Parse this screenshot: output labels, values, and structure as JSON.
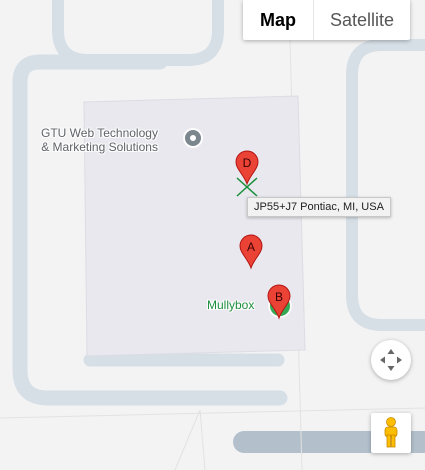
{
  "map_type": {
    "map_label": "Map",
    "satellite_label": "Satellite",
    "selected": "Map"
  },
  "places": {
    "gtu": {
      "line1": "GTU Web Technology",
      "line2": "& Marketing Solutions"
    },
    "mullybox": "Mullybox"
  },
  "markers": [
    {
      "label": "D"
    },
    {
      "label": "A"
    },
    {
      "label": "B"
    }
  ],
  "tooltip": "JP55+J7 Pontiac, MI, USA",
  "colors": {
    "background": "#f3f3f4",
    "road": "#d6dfe6",
    "building": "#e8e8ee",
    "marker": "#ea4335",
    "poi_green": "#34a853",
    "poi_gray": "#7b868d",
    "cross": "#1a8f3a"
  },
  "controls": {
    "pan": "move-arrows-icon",
    "street_view": "pegman-icon"
  }
}
